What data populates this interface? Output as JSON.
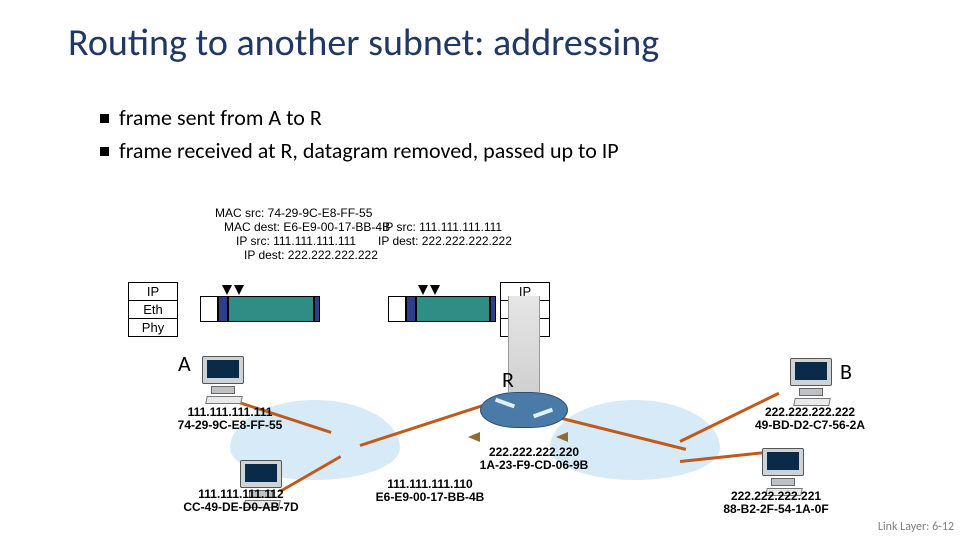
{
  "title": "Routing to another subnet: addressing",
  "bullets": [
    "frame sent from A to R",
    "frame received at R, datagram removed, passed up to IP"
  ],
  "packet1": {
    "l1": "MAC src: 74-29-9C-E8-FF-55",
    "l2a": "MAC dest: E6-E9-00-17-BB-4B",
    "l2b": "IP src: 111.111.111.111",
    "l3a": "IP src: 111.111.111.111",
    "l3b": "IP dest: 222.222.222.222",
    "l4": "IP dest: 222.222.222.222"
  },
  "stack": {
    "l1": "IP",
    "l2": "Eth",
    "l3": "Phy"
  },
  "hosts": {
    "A": "A",
    "R": "R",
    "B": "B"
  },
  "addrs": {
    "a": "111.111.111.111\n74-29-9C-E8-FF-55",
    "a2": "111.111.111.112\nCC-49-DE-D0-AB-7D",
    "r_l": "111.111.111.110\nE6-E9-00-17-BB-4B",
    "r_r": "222.222.222.220\n1A-23-F9-CD-06-9B",
    "b": "222.222.222.222\n49-BD-D2-C7-56-2A",
    "b2": "222.222.222.221\n88-B2-2F-54-1A-0F"
  },
  "footer": "Link Layer: 6-12"
}
